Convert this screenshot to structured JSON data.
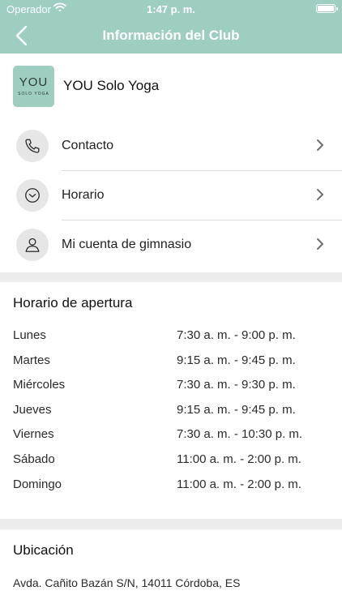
{
  "status_bar": {
    "carrier": "Operador",
    "time": "1:47 p. m."
  },
  "nav": {
    "title": "Información del Club"
  },
  "club": {
    "logo_main": "YOU",
    "logo_sub": "SOLO YOGA",
    "name": "YOU Solo Yoga"
  },
  "menu": [
    {
      "label": "Contacto",
      "icon": "phone-icon"
    },
    {
      "label": "Horario",
      "icon": "clock-icon"
    },
    {
      "label": "Mi cuenta de gimnasio",
      "icon": "user-icon"
    }
  ],
  "hours": {
    "title": "Horario de apertura",
    "rows": [
      {
        "day": "Lunes",
        "time": "7:30 a. m. - 9:00 p. m."
      },
      {
        "day": "Martes",
        "time": "9:15 a. m. - 9:45 p. m."
      },
      {
        "day": "Miércoles",
        "time": "7:30 a. m. - 9:30 p. m."
      },
      {
        "day": "Jueves",
        "time": "9:15 a. m. - 9:45 p. m."
      },
      {
        "day": "Viernes",
        "time": "7:30 a. m. - 10:30 p. m."
      },
      {
        "day": "Sábado",
        "time": "11:00 a. m. - 2:00 p. m."
      },
      {
        "day": "Domingo",
        "time": "11:00 a. m. - 2:00 p. m."
      }
    ]
  },
  "location": {
    "title": "Ubicación",
    "address": "Avda. Cañito Bazán S/N, 14011 Córdoba, ES"
  },
  "colors": {
    "accent": "#9dcec0",
    "icon_circle": "#e6e6e6",
    "page_bg": "#ececec"
  }
}
